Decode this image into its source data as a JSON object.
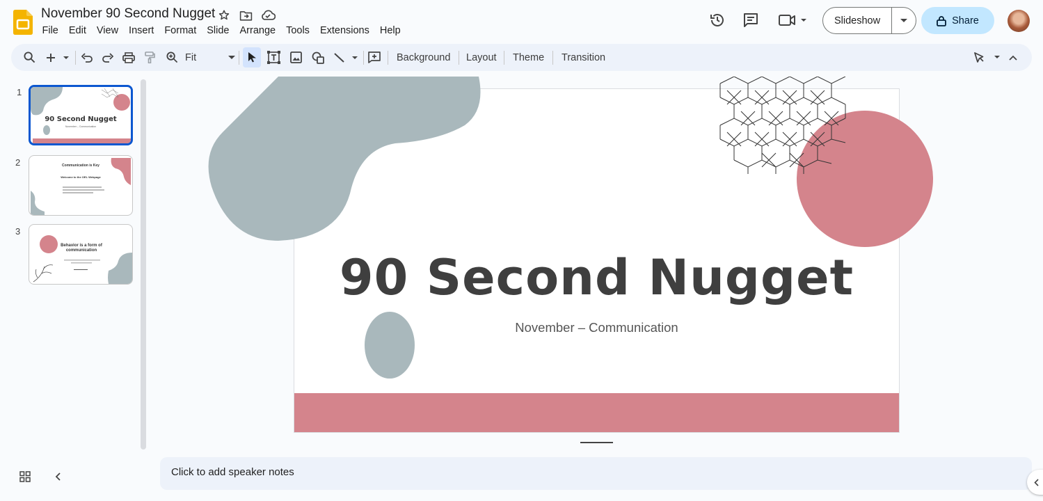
{
  "app": {
    "title": "November 90 Second Nugget",
    "menu": [
      "File",
      "Edit",
      "View",
      "Insert",
      "Format",
      "Slide",
      "Arrange",
      "Tools",
      "Extensions",
      "Help"
    ],
    "slideshow_label": "Slideshow",
    "share_label": "Share"
  },
  "toolbar": {
    "zoom_label": "Fit",
    "background_label": "Background",
    "layout_label": "Layout",
    "theme_label": "Theme",
    "transition_label": "Transition"
  },
  "filmstrip": {
    "slides": [
      {
        "number": "1",
        "title": "90 Second Nugget",
        "subtitle": "November – Communication"
      },
      {
        "number": "2",
        "title": "Communication is Key",
        "subtitle": "Welcome to the OEL Webpage"
      },
      {
        "number": "3",
        "title": "Behavior is a form of communication"
      }
    ]
  },
  "slide": {
    "title": "90 Second Nugget",
    "subtitle": "November – Communication"
  },
  "notes": {
    "placeholder": "Click to add speaker notes"
  },
  "colors": {
    "accent_pink": "#d4848c",
    "shape_gray": "#a9b8bc",
    "share_bg": "#c2e7ff",
    "selection_blue": "#0b57d0"
  }
}
